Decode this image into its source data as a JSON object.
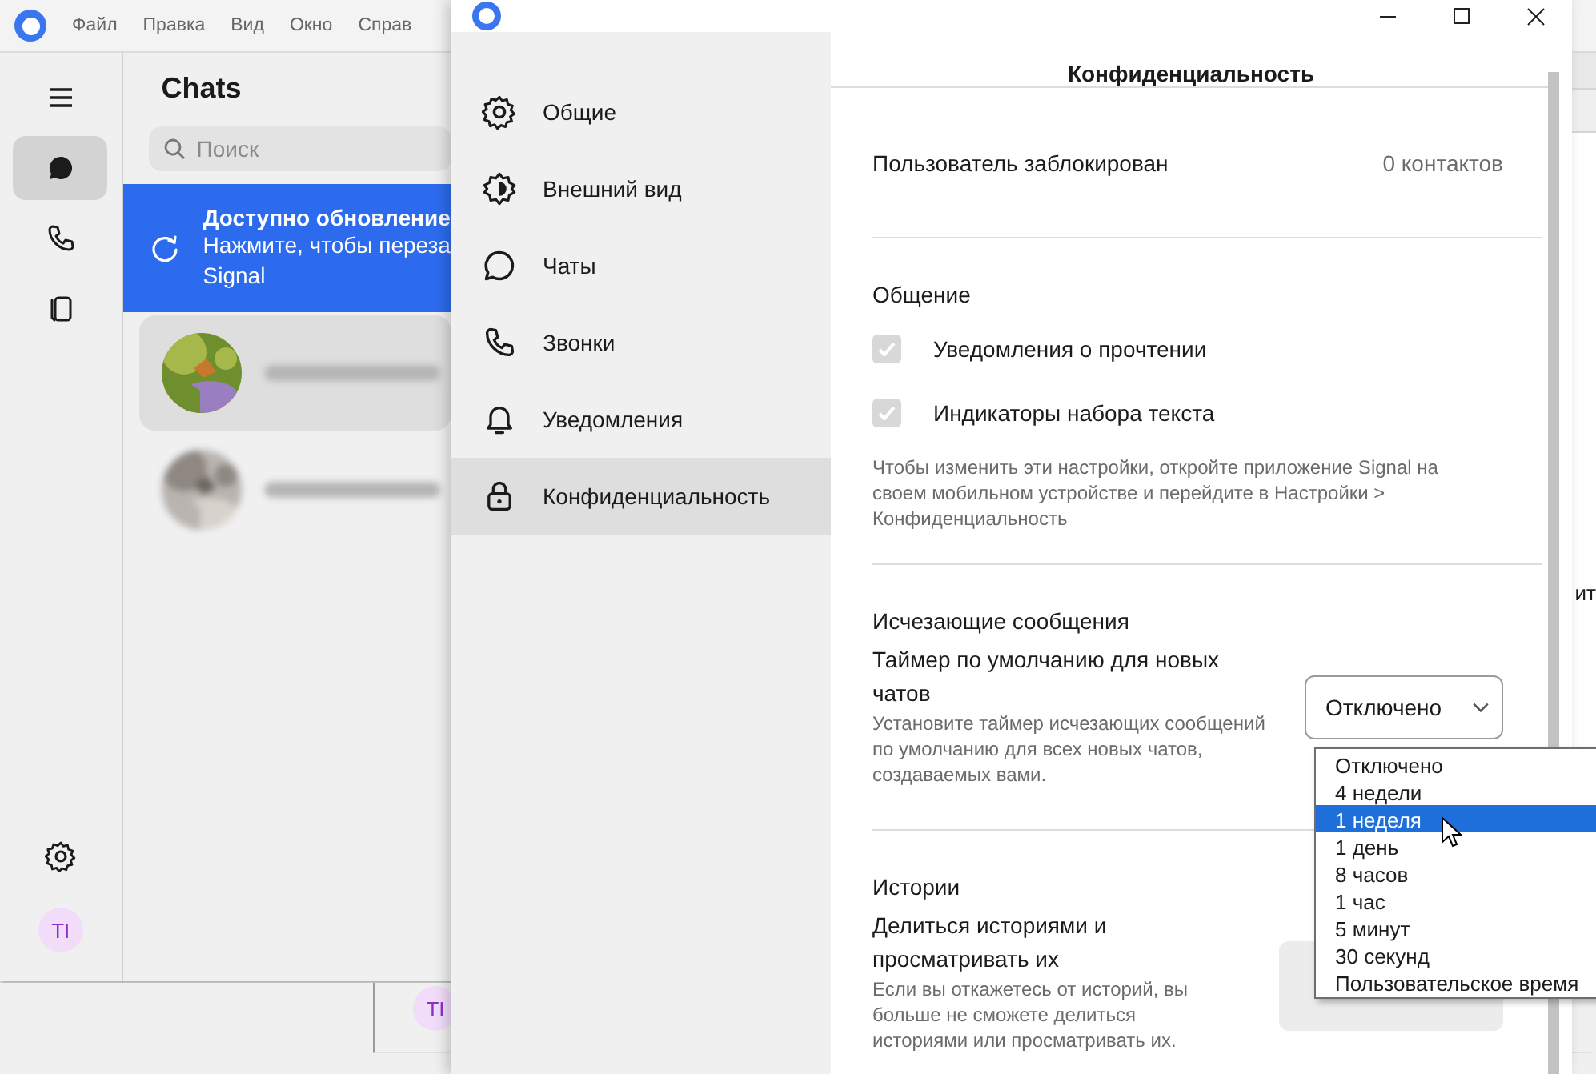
{
  "back_window": {
    "menu": [
      "Файл",
      "Правка",
      "Вид",
      "Окно",
      "Справ"
    ],
    "nav": [
      {
        "kind": "chats",
        "selected": true
      },
      {
        "kind": "calls",
        "selected": false
      },
      {
        "kind": "stories",
        "selected": false
      }
    ],
    "title": "Chats",
    "search": {
      "placeholder": "Поиск"
    },
    "update_banner": {
      "title": "Доступно обновление",
      "lines": [
        "Нажмите, чтобы переза",
        "Signal"
      ]
    },
    "chats": [
      {
        "kind": "picture",
        "selected": true
      },
      {
        "kind": "picture",
        "selected": false
      }
    ],
    "profile_initials": "TI",
    "right_edge_text": "ит"
  },
  "lower_window": {
    "initials": "TI"
  },
  "settings": {
    "sidebar": [
      {
        "kind": "gear",
        "label": "Общие",
        "selected": false
      },
      {
        "kind": "appearance",
        "label": "Внешний вид",
        "selected": false
      },
      {
        "kind": "chat",
        "label": "Чаты",
        "selected": false
      },
      {
        "kind": "phone",
        "label": "Звонки",
        "selected": false
      },
      {
        "kind": "bell",
        "label": "Уведомления",
        "selected": false
      },
      {
        "kind": "lock",
        "label": "Конфиденциальность",
        "selected": true
      }
    ],
    "header": "Конфиденциальность",
    "blocked": {
      "label": "Пользователь заблокирован",
      "value": "0 контактов"
    },
    "communication": {
      "title": "Общение",
      "options": [
        {
          "label": "Уведомления о прочтении",
          "checked": true,
          "disabled": true
        },
        {
          "label": "Индикаторы набора текста",
          "checked": true,
          "disabled": true
        }
      ],
      "note": "Чтобы изменить эти настройки, откройте приложение Signal на своем мобильном устройстве и перейдите в Настройки > Конфиденциальность"
    },
    "disappearing": {
      "title": "Исчезающие сообщения",
      "label": "Таймер по умолчанию для новых чатов",
      "description": "Установите таймер исчезающих сообщений по умолчанию для всех новых чатов, создаваемых вами.",
      "select": {
        "value": "Отключено",
        "expanded": true,
        "options": [
          {
            "label": "Отключено",
            "highlighted": false
          },
          {
            "label": "4 недели",
            "highlighted": false
          },
          {
            "label": "1 неделя",
            "highlighted": true
          },
          {
            "label": "1 день",
            "highlighted": false
          },
          {
            "label": "8 часов",
            "highlighted": false
          },
          {
            "label": "1 час",
            "highlighted": false
          },
          {
            "label": "5 минут",
            "highlighted": false
          },
          {
            "label": "30 секунд",
            "highlighted": false
          },
          {
            "label": "Пользовательское время",
            "highlighted": false
          }
        ]
      }
    },
    "stories": {
      "title": "Истории",
      "label": "Делиться историями и просматривать их",
      "description": "Если вы откажетесь от историй, вы больше не сможете делиться историями или просматривать их."
    }
  }
}
